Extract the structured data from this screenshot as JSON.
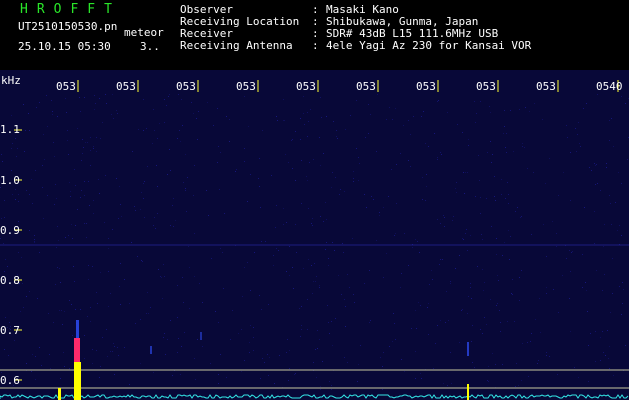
{
  "header": {
    "logo": "HROFFT",
    "file_name": "UT2510150530.pn",
    "tag": "meteor",
    "timestamp": "25.10.15 05:30",
    "count": "3..",
    "fields": [
      {
        "key": "Observer",
        "value": "Masaki Kano"
      },
      {
        "key": "Receiving Location",
        "value": "Shibukawa, Gunma, Japan"
      },
      {
        "key": "Receiver",
        "value": "SDR# 43dB L15 111.6MHz USB"
      },
      {
        "key": "Receiving Antenna",
        "value": "4ele Yagi Az 230 for Kansai VOR"
      }
    ],
    "colon": ":"
  },
  "spectrogram": {
    "unit_label": "kHz",
    "y_ticks": [
      "1.1",
      "1.0",
      "0.9",
      "0.8",
      "0.7",
      "0.6"
    ],
    "x_ticks": [
      "053",
      "053",
      "053",
      "053",
      "053",
      "053",
      "053",
      "053",
      "053",
      "0540"
    ],
    "colors": {
      "background": "#080838",
      "noise": "#1a1a8a",
      "grid_tick": "#ffff33",
      "ref_line": "#c8c8a0",
      "baseline": "#33e6e6",
      "meteor_core": "#ffff00",
      "meteor_hot": "#ff2a6a"
    }
  }
}
